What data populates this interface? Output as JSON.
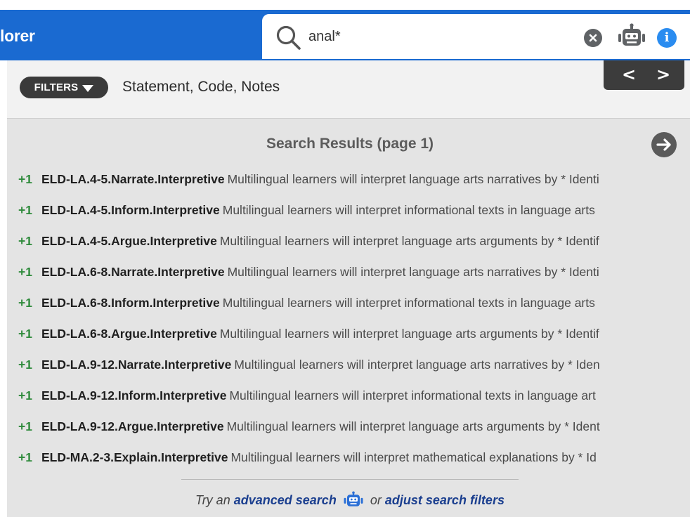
{
  "app": {
    "title": "lorer"
  },
  "search": {
    "value": "anal*",
    "placeholder": ""
  },
  "filters": {
    "button_label": "FILTERS",
    "summary": "Statement, Code, Notes"
  },
  "nav": {
    "prev_label": "<",
    "next_label": ">"
  },
  "info": {
    "glyph": "i"
  },
  "results": {
    "title": "Search Results (page 1)",
    "items": [
      {
        "badge": "+1",
        "code": "ELD-LA.4-5.Narrate.Interpretive",
        "text": "Multilingual learners will interpret language arts narratives by * Identi"
      },
      {
        "badge": "+1",
        "code": "ELD-LA.4-5.Inform.Interpretive",
        "text": "Multilingual learners will interpret informational texts in language arts"
      },
      {
        "badge": "+1",
        "code": "ELD-LA.4-5.Argue.Interpretive",
        "text": "Multilingual learners will interpret language arts arguments by * Identif"
      },
      {
        "badge": "+1",
        "code": "ELD-LA.6-8.Narrate.Interpretive",
        "text": "Multilingual learners will interpret language arts narratives by * Identi"
      },
      {
        "badge": "+1",
        "code": "ELD-LA.6-8.Inform.Interpretive",
        "text": "Multilingual learners will interpret informational texts in language arts"
      },
      {
        "badge": "+1",
        "code": "ELD-LA.6-8.Argue.Interpretive",
        "text": "Multilingual learners will interpret language arts arguments by * Identif"
      },
      {
        "badge": "+1",
        "code": "ELD-LA.9-12.Narrate.Interpretive",
        "text": "Multilingual learners will interpret language arts narratives by * Iden"
      },
      {
        "badge": "+1",
        "code": "ELD-LA.9-12.Inform.Interpretive",
        "text": "Multilingual learners will interpret informational texts in language art"
      },
      {
        "badge": "+1",
        "code": "ELD-LA.9-12.Argue.Interpretive",
        "text": "Multilingual learners will interpret language arts arguments by * Ident"
      },
      {
        "badge": "+1",
        "code": "ELD-MA.2-3.Explain.Interpretive",
        "text": "Multilingual learners will interpret mathematical explanations by * Id"
      }
    ]
  },
  "footer": {
    "prefix": "Try an",
    "advanced_link": "advanced search",
    "middle": "or",
    "adjust_link": "adjust search filters"
  },
  "colors": {
    "brand": "#1a6ad1",
    "badge": "#2e8a3b",
    "link": "#1b3f8f",
    "info": "#2a8cf0"
  }
}
